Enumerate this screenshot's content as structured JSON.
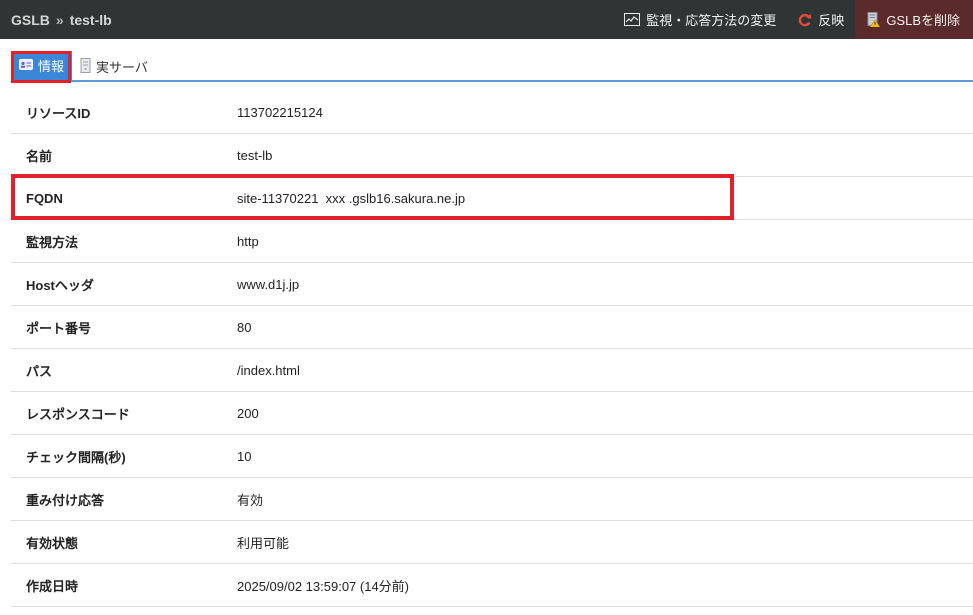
{
  "header": {
    "breadcrumb_root": "GSLB",
    "breadcrumb_sep": "»",
    "breadcrumb_current": "test-lb",
    "actions": {
      "monitor_label": "監視・応答方法の変更",
      "apply_label": "反映",
      "delete_label": "GSLBを削除"
    }
  },
  "tabs": [
    {
      "label": "情報",
      "icon": "info-card-icon",
      "active": true
    },
    {
      "label": "実サーバ",
      "icon": "server-icon",
      "active": false
    }
  ],
  "info": {
    "rows": [
      {
        "label": "リソースID",
        "value": "113702215124"
      },
      {
        "label": "名前",
        "value": "test-lb"
      },
      {
        "label": "FQDN",
        "value": "site-11370221  xxx .gslb16.sakura.ne.jp"
      },
      {
        "label": "監視方法",
        "value": "http"
      },
      {
        "label": "Hostヘッダ",
        "value": "www.d1j.jp"
      },
      {
        "label": "ポート番号",
        "value": "80"
      },
      {
        "label": "パス",
        "value": "/index.html"
      },
      {
        "label": "レスポンスコード",
        "value": "200"
      },
      {
        "label": "チェック間隔(秒)",
        "value": "10"
      },
      {
        "label": "重み付け応答",
        "value": "有効"
      },
      {
        "label": "有効状態",
        "value": "利用可能"
      },
      {
        "label": "作成日時",
        "value": "2025/09/02 13:59:07 (14分前)"
      }
    ]
  },
  "colors": {
    "topbar": "#2e3534",
    "delete_bg": "#5b2a2a",
    "tab_active": "#3b86d6",
    "highlight": "#e0202a"
  }
}
